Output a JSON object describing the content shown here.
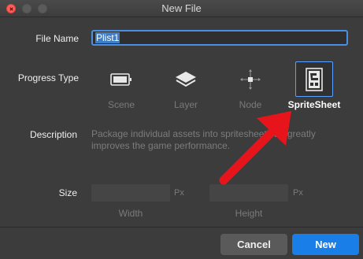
{
  "window": {
    "title": "New File"
  },
  "form": {
    "file_name_label": "File Name",
    "file_name_value": "Plist1",
    "progress_type_label": "Progress Type",
    "types": [
      {
        "label": "Scene",
        "icon": "scene-icon",
        "selected": false
      },
      {
        "label": "Layer",
        "icon": "layer-icon",
        "selected": false
      },
      {
        "label": "Node",
        "icon": "node-icon",
        "selected": false
      },
      {
        "label": "SpriteSheet",
        "icon": "spritesheet-icon",
        "selected": true
      }
    ],
    "description_label": "Description",
    "description_text": "Package individual assets into spritesheet can greatly improves the game performance.",
    "size_label": "Size",
    "width_unit": "Px",
    "height_unit": "Px",
    "width_label": "Width",
    "height_label": "Height"
  },
  "buttons": {
    "cancel": "Cancel",
    "new": "New"
  },
  "colors": {
    "accent": "#1a7ee8",
    "selection_border": "#5aa0ff",
    "annotation_arrow": "#e8141c"
  }
}
